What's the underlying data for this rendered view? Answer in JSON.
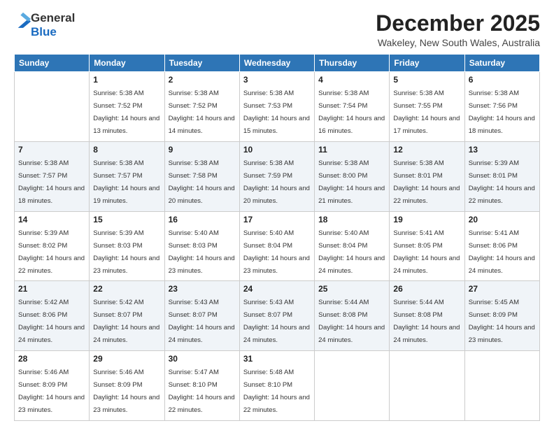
{
  "header": {
    "logo": {
      "general": "General",
      "blue": "Blue"
    },
    "title": "December 2025",
    "location": "Wakeley, New South Wales, Australia"
  },
  "weekdays": [
    "Sunday",
    "Monday",
    "Tuesday",
    "Wednesday",
    "Thursday",
    "Friday",
    "Saturday"
  ],
  "weeks": [
    [
      {
        "day": "",
        "sunrise": "",
        "sunset": "",
        "daylight": ""
      },
      {
        "day": "1",
        "sunrise": "Sunrise: 5:38 AM",
        "sunset": "Sunset: 7:52 PM",
        "daylight": "Daylight: 14 hours and 13 minutes."
      },
      {
        "day": "2",
        "sunrise": "Sunrise: 5:38 AM",
        "sunset": "Sunset: 7:52 PM",
        "daylight": "Daylight: 14 hours and 14 minutes."
      },
      {
        "day": "3",
        "sunrise": "Sunrise: 5:38 AM",
        "sunset": "Sunset: 7:53 PM",
        "daylight": "Daylight: 14 hours and 15 minutes."
      },
      {
        "day": "4",
        "sunrise": "Sunrise: 5:38 AM",
        "sunset": "Sunset: 7:54 PM",
        "daylight": "Daylight: 14 hours and 16 minutes."
      },
      {
        "day": "5",
        "sunrise": "Sunrise: 5:38 AM",
        "sunset": "Sunset: 7:55 PM",
        "daylight": "Daylight: 14 hours and 17 minutes."
      },
      {
        "day": "6",
        "sunrise": "Sunrise: 5:38 AM",
        "sunset": "Sunset: 7:56 PM",
        "daylight": "Daylight: 14 hours and 18 minutes."
      }
    ],
    [
      {
        "day": "7",
        "sunrise": "Sunrise: 5:38 AM",
        "sunset": "Sunset: 7:57 PM",
        "daylight": "Daylight: 14 hours and 18 minutes."
      },
      {
        "day": "8",
        "sunrise": "Sunrise: 5:38 AM",
        "sunset": "Sunset: 7:57 PM",
        "daylight": "Daylight: 14 hours and 19 minutes."
      },
      {
        "day": "9",
        "sunrise": "Sunrise: 5:38 AM",
        "sunset": "Sunset: 7:58 PM",
        "daylight": "Daylight: 14 hours and 20 minutes."
      },
      {
        "day": "10",
        "sunrise": "Sunrise: 5:38 AM",
        "sunset": "Sunset: 7:59 PM",
        "daylight": "Daylight: 14 hours and 20 minutes."
      },
      {
        "day": "11",
        "sunrise": "Sunrise: 5:38 AM",
        "sunset": "Sunset: 8:00 PM",
        "daylight": "Daylight: 14 hours and 21 minutes."
      },
      {
        "day": "12",
        "sunrise": "Sunrise: 5:38 AM",
        "sunset": "Sunset: 8:01 PM",
        "daylight": "Daylight: 14 hours and 22 minutes."
      },
      {
        "day": "13",
        "sunrise": "Sunrise: 5:39 AM",
        "sunset": "Sunset: 8:01 PM",
        "daylight": "Daylight: 14 hours and 22 minutes."
      }
    ],
    [
      {
        "day": "14",
        "sunrise": "Sunrise: 5:39 AM",
        "sunset": "Sunset: 8:02 PM",
        "daylight": "Daylight: 14 hours and 22 minutes."
      },
      {
        "day": "15",
        "sunrise": "Sunrise: 5:39 AM",
        "sunset": "Sunset: 8:03 PM",
        "daylight": "Daylight: 14 hours and 23 minutes."
      },
      {
        "day": "16",
        "sunrise": "Sunrise: 5:40 AM",
        "sunset": "Sunset: 8:03 PM",
        "daylight": "Daylight: 14 hours and 23 minutes."
      },
      {
        "day": "17",
        "sunrise": "Sunrise: 5:40 AM",
        "sunset": "Sunset: 8:04 PM",
        "daylight": "Daylight: 14 hours and 23 minutes."
      },
      {
        "day": "18",
        "sunrise": "Sunrise: 5:40 AM",
        "sunset": "Sunset: 8:04 PM",
        "daylight": "Daylight: 14 hours and 24 minutes."
      },
      {
        "day": "19",
        "sunrise": "Sunrise: 5:41 AM",
        "sunset": "Sunset: 8:05 PM",
        "daylight": "Daylight: 14 hours and 24 minutes."
      },
      {
        "day": "20",
        "sunrise": "Sunrise: 5:41 AM",
        "sunset": "Sunset: 8:06 PM",
        "daylight": "Daylight: 14 hours and 24 minutes."
      }
    ],
    [
      {
        "day": "21",
        "sunrise": "Sunrise: 5:42 AM",
        "sunset": "Sunset: 8:06 PM",
        "daylight": "Daylight: 14 hours and 24 minutes."
      },
      {
        "day": "22",
        "sunrise": "Sunrise: 5:42 AM",
        "sunset": "Sunset: 8:07 PM",
        "daylight": "Daylight: 14 hours and 24 minutes."
      },
      {
        "day": "23",
        "sunrise": "Sunrise: 5:43 AM",
        "sunset": "Sunset: 8:07 PM",
        "daylight": "Daylight: 14 hours and 24 minutes."
      },
      {
        "day": "24",
        "sunrise": "Sunrise: 5:43 AM",
        "sunset": "Sunset: 8:07 PM",
        "daylight": "Daylight: 14 hours and 24 minutes."
      },
      {
        "day": "25",
        "sunrise": "Sunrise: 5:44 AM",
        "sunset": "Sunset: 8:08 PM",
        "daylight": "Daylight: 14 hours and 24 minutes."
      },
      {
        "day": "26",
        "sunrise": "Sunrise: 5:44 AM",
        "sunset": "Sunset: 8:08 PM",
        "daylight": "Daylight: 14 hours and 24 minutes."
      },
      {
        "day": "27",
        "sunrise": "Sunrise: 5:45 AM",
        "sunset": "Sunset: 8:09 PM",
        "daylight": "Daylight: 14 hours and 23 minutes."
      }
    ],
    [
      {
        "day": "28",
        "sunrise": "Sunrise: 5:46 AM",
        "sunset": "Sunset: 8:09 PM",
        "daylight": "Daylight: 14 hours and 23 minutes."
      },
      {
        "day": "29",
        "sunrise": "Sunrise: 5:46 AM",
        "sunset": "Sunset: 8:09 PM",
        "daylight": "Daylight: 14 hours and 23 minutes."
      },
      {
        "day": "30",
        "sunrise": "Sunrise: 5:47 AM",
        "sunset": "Sunset: 8:10 PM",
        "daylight": "Daylight: 14 hours and 22 minutes."
      },
      {
        "day": "31",
        "sunrise": "Sunrise: 5:48 AM",
        "sunset": "Sunset: 8:10 PM",
        "daylight": "Daylight: 14 hours and 22 minutes."
      },
      {
        "day": "",
        "sunrise": "",
        "sunset": "",
        "daylight": ""
      },
      {
        "day": "",
        "sunrise": "",
        "sunset": "",
        "daylight": ""
      },
      {
        "day": "",
        "sunrise": "",
        "sunset": "",
        "daylight": ""
      }
    ]
  ]
}
